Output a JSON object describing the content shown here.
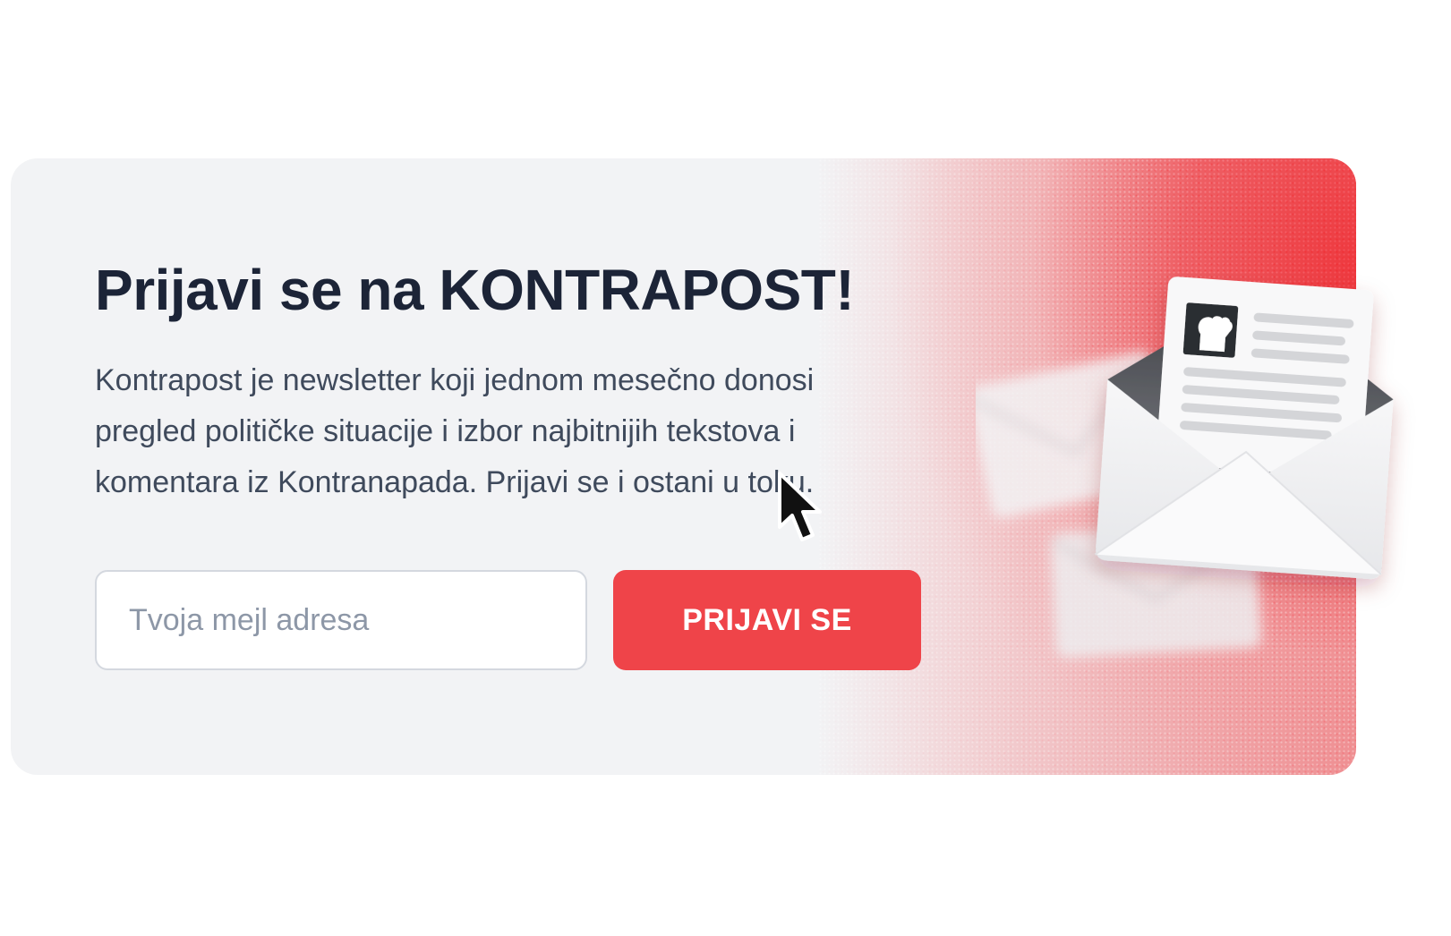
{
  "signup": {
    "title": "Prijavi se na KONTRAPOST!",
    "description": "Kontrapost je newsletter koji jednom mesečno donosi pregled političke situacije i izbor najbitnijih tekstova i komentara iz Kontranapada. Prijavi se i ostani u toku.",
    "email_placeholder": "Tvoja mejl adresa",
    "email_value": "",
    "submit_label": "PRIJAVI SE"
  },
  "illustration": {
    "icons": [
      "envelope-icon",
      "newsletter-letter-icon",
      "raised-fist-icon",
      "cursor-pointer-icon"
    ]
  },
  "colors": {
    "accent": "#ef4449",
    "title": "#1c2437",
    "text": "#3f4a5c",
    "card_background": "#f2f3f5",
    "placeholder": "#8d97a7"
  }
}
